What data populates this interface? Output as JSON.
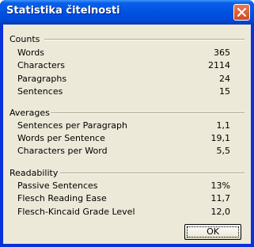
{
  "window": {
    "title": "Statistika čitelnosti",
    "close_icon": "close-icon"
  },
  "counts": {
    "label": "Counts",
    "rows": [
      {
        "label": "Words",
        "value": "365"
      },
      {
        "label": "Characters",
        "value": "2114"
      },
      {
        "label": "Paragraphs",
        "value": "24"
      },
      {
        "label": "Sentences",
        "value": "15"
      }
    ]
  },
  "averages": {
    "label": "Averages",
    "rows": [
      {
        "label": "Sentences per Paragraph",
        "value": "1,1"
      },
      {
        "label": "Words per Sentence",
        "value": "19,1"
      },
      {
        "label": "Characters per Word",
        "value": "5,5"
      }
    ]
  },
  "readability": {
    "label": "Readability",
    "rows": [
      {
        "label": "Passive Sentences",
        "value": "13%"
      },
      {
        "label": "Flesch Reading Ease",
        "value": "11,7"
      },
      {
        "label": "Flesch-Kincaid Grade Level",
        "value": "12,0"
      }
    ]
  },
  "buttons": {
    "ok_label": "OK"
  }
}
